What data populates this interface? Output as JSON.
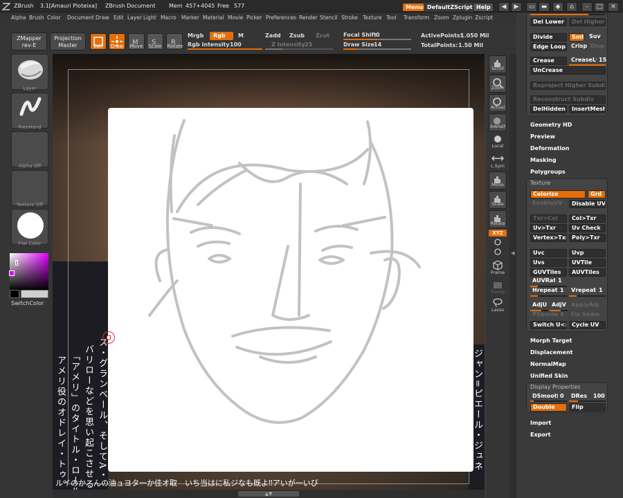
{
  "titlebar": {
    "app": "ZBrush",
    "version": "3.1[Amauri Ploteixa]",
    "document": "ZBrush Document",
    "mem": "Mem",
    "mem_value": "457+4045",
    "free": "Free",
    "free_value": "577",
    "menus_btn": "Menus",
    "zscript_btn": "DefaultZScript",
    "help_btn": "Help"
  },
  "menubar": [
    "Alpha",
    "Brush",
    "Color",
    "Document",
    "Draw",
    "Edit",
    "Layer",
    "Light",
    "Macro",
    "Marker",
    "Material",
    "Movie",
    "Picker",
    "Preferences",
    "Render",
    "Stencil",
    "Stroke",
    "Texture",
    "Tool",
    "Transform",
    "Zoom",
    "Zplugin",
    "Zscript"
  ],
  "shelf": {
    "zmapper": "ZMapper",
    "zmapper_sub": "rev-E",
    "projection": "Projection",
    "projection_sub": "Master",
    "tools": [
      "Edit",
      "Draw",
      "Move",
      "Scale",
      "Rotate"
    ],
    "mrgb": "Mrgb",
    "rgb": "Rgb",
    "m": "M",
    "rgb_intensity_label": "Rgb Intensity",
    "rgb_intensity": "100",
    "zadd": "Zadd",
    "zsub": "Zsub",
    "zcut": "Zcut",
    "z_intensity_label": "Z Intensity",
    "z_intensity": "25",
    "focal_shift_label": "Focal Shift",
    "focal_shift": "0",
    "draw_size_label": "Draw Size",
    "draw_size": "14",
    "active_points_label": "ActivePoints:",
    "active_points": "1.050 Mil",
    "total_points_label": "TotalPoints:",
    "total_points": "1.50 Mil"
  },
  "lefttray": {
    "tiles": [
      "Layer",
      "FreeHand",
      "Alpha Off",
      "Texture Off",
      "Flat Color"
    ],
    "switch_color": "SwitchColor"
  },
  "rightshelf": [
    "Scroll",
    "Zoom",
    "Actual",
    "AAHalf",
    "Local",
    "L.Sym",
    "Move",
    "Scale",
    "Rotate",
    "XYZ",
    "Frame",
    "Transp",
    "Lasso"
  ],
  "palette": {
    "del_lower": "Del Lower",
    "del_higher": "Del Higher",
    "divide": "Divide",
    "smt": "Smt",
    "suv": "Suv",
    "edge_loop": "Edge Loop",
    "crisp": "Crisp",
    "disp": "Disp",
    "crease": "Crease",
    "crease_lvl_label": "CreaseLvl",
    "crease_lvl": "15",
    "uncrease": "UnCrease",
    "reproject": "Reproject Higher Subdiv",
    "reconstruct": "Reconstruct Subdiv",
    "del_hidden": "DelHidden",
    "insert_mesh": "InsertMesh",
    "sections": [
      "Geometry HD",
      "Preview",
      "Deformation",
      "Masking",
      "Polygroups"
    ],
    "texture_header": "Texture",
    "colorize": "Colorize",
    "grd": "Grd",
    "enable_uv": "EnableUV",
    "disable_uv": "Disable UV",
    "txr_col": "Txr>Col",
    "col_txr": "Col>Txr",
    "uv_txr": "Uv>Txr",
    "uv_check": "Uv Check",
    "vertex_txr": "Vertex>Txr",
    "poly_txr": "Poly>Txr",
    "uvc": "Uvc",
    "uvp": "Uvp",
    "uvs": "Uvs",
    "uvtile": "UVTile",
    "guvtiles": "GUVTiles",
    "auvtiles": "AUVTiles",
    "auvratio_label": "AUVRatio",
    "auvratio": "1",
    "hrepeat_label": "Hrepeat",
    "hrepeat": "1",
    "vrepeat_label": "Vrepeat",
    "vrepeat": "1",
    "adju": "AdjU",
    "adjv": "AdjV",
    "apply_adj": "ApplyAdj",
    "psborder_label": "PSborder",
    "psborder": "4",
    "fix_seam": "Fix Seam",
    "switch_uv": "Switch U<>V",
    "cycle_uv": "Cycle UV",
    "sections2": [
      "Morph Target",
      "Displacement",
      "NormalMap",
      "Unified Skin"
    ],
    "display_header": "Display Properties",
    "dsmooth_label": "DSmooth",
    "dsmooth": "0",
    "dres_label": "DRes",
    "dres": "100",
    "double": "Double",
    "flip": "Flip",
    "import": "Import",
    "export": "Export"
  },
  "magazine": {
    "col1": "アメリ役のオドレイ・トゥ。",
    "col2": "「アメリ」のタイトル・ロール。",
    "col3": "バリローなどを思い起こさせる",
    "col4": "ス・グランベール、そしてA・",
    "col5": "ジャン=ピエール・ジュネ",
    "bottom": "ルイのか　んの油ュヨタ一か佳オ取　いち当はに私ジなも既よ‼アいが一いび"
  },
  "colors": {
    "accent": "#e36e0a",
    "background": "#3c3c3c"
  }
}
